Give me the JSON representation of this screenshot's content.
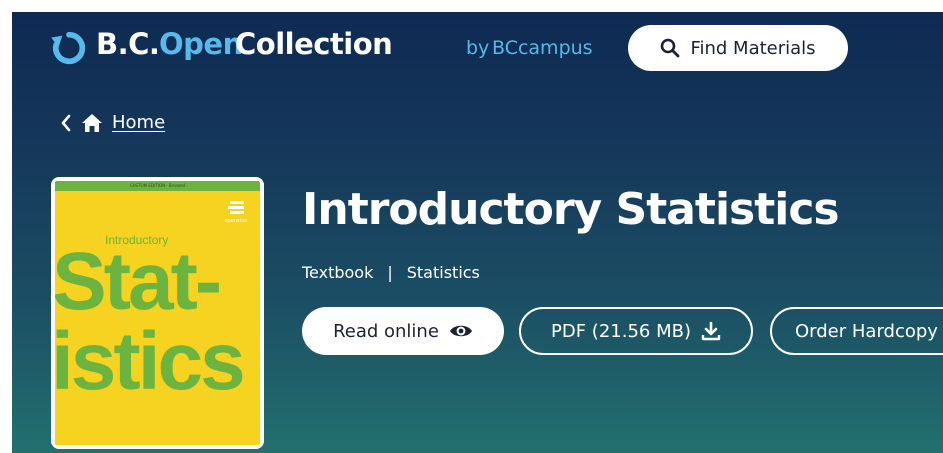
{
  "header": {
    "brand_bc": "B.C.",
    "brand_open": "Open",
    "brand_collection": "Collection",
    "brand_by": "by",
    "brand_bccampus": "BCcampus",
    "find_label": "Find Materials"
  },
  "breadcrumb": {
    "home_label": "Home"
  },
  "cover": {
    "intro_word": "Introductory",
    "stat_word": "Stat-",
    "istics_word": "istics",
    "openstax": "openstax",
    "band_text": "CUSTOM EDITION · Bronzed"
  },
  "book": {
    "title": "Introductory Statistics",
    "type": "Textbook",
    "separator": "|",
    "subject": "Statistics"
  },
  "actions": {
    "read_label": "Read online",
    "pdf_label": "PDF (21.56 MB)",
    "order_label": "Order Hardcopy"
  },
  "colors": {
    "accent_blue": "#57b9ec",
    "cover_yellow": "#f5d320",
    "cover_green": "#6cb33f",
    "bg_top": "#0e2a52",
    "bg_bottom": "#22706e"
  },
  "icons": [
    "refresh-icon",
    "search-icon",
    "chevron-left-icon",
    "home-icon",
    "eye-icon",
    "download-icon"
  ]
}
